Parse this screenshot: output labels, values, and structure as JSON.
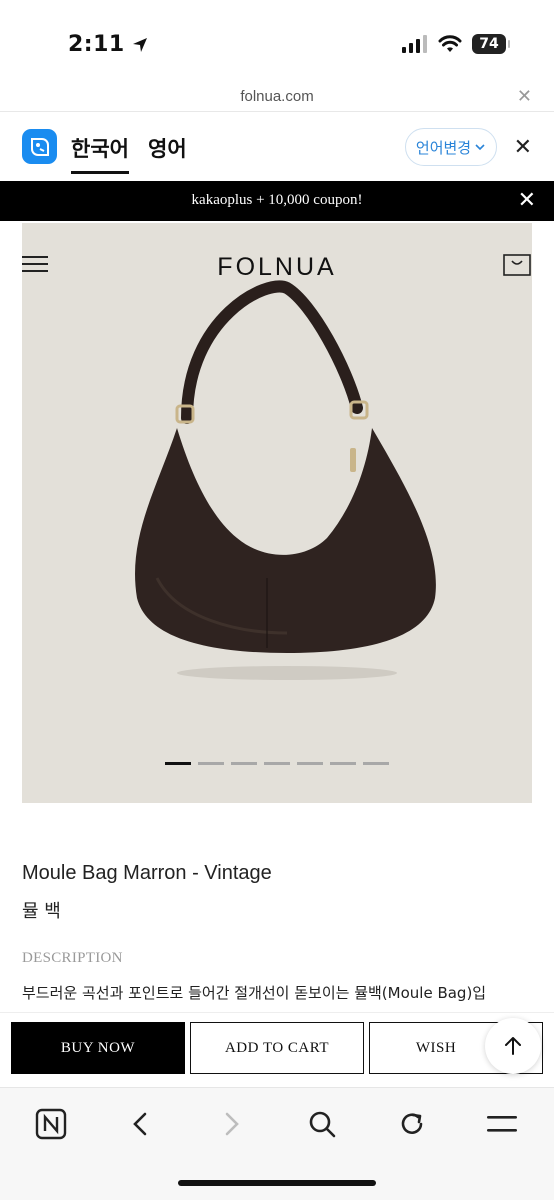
{
  "status_bar": {
    "time": "2:11",
    "battery": "74"
  },
  "browser": {
    "url": "folnua.com"
  },
  "translate_bar": {
    "lang_current": "한국어",
    "lang_target": "영어",
    "change_label": "언어변경"
  },
  "banner": {
    "text": "kakaoplus + 10,000 coupon!"
  },
  "header": {
    "brand": "FOLNUA"
  },
  "carousel": {
    "slide_count": 7,
    "active_index": 0
  },
  "product": {
    "name": "Moule Bag Marron - Vintage",
    "name_ko": "뮬 백",
    "description_label": "DESCRIPTION",
    "description_text": "부드러운 곡선과 포인트로 들어간 절개선이 돋보이는 뮬백(Moule Bag)입"
  },
  "actions": {
    "buy_now": "BUY NOW",
    "add_to_cart": "ADD TO CART",
    "wish": "WISH"
  },
  "colors": {
    "accent_blue": "#1a8cf0",
    "banner_bg": "#000000",
    "hero_bg": "#e3e0d9",
    "bag_color": "#2f2320"
  }
}
